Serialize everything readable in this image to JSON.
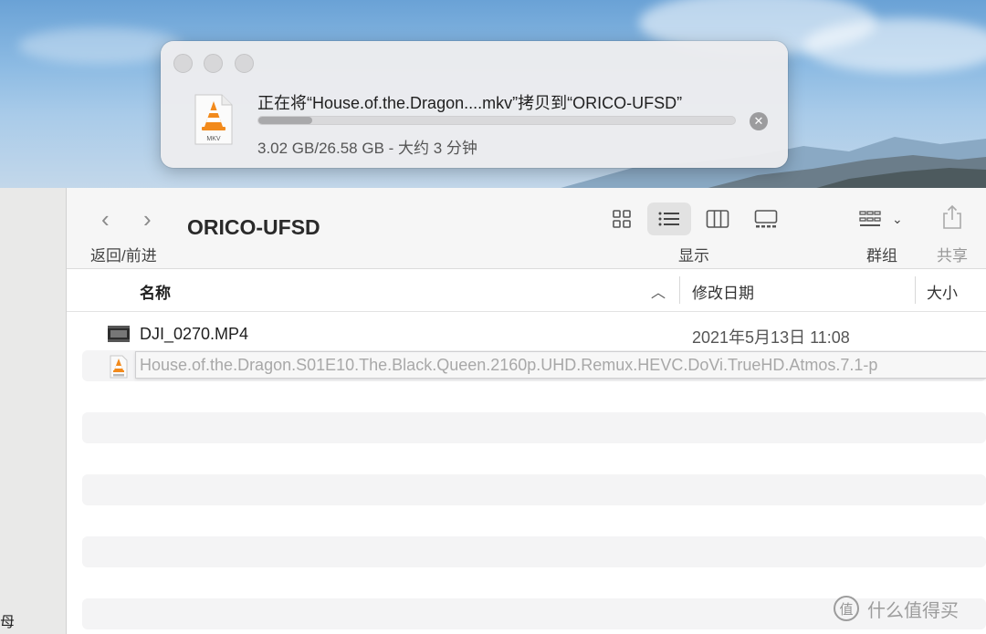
{
  "copy_dialog": {
    "title": "正在将“House.of.the.Dragon....mkv”拷贝到“ORICO-UFSD”",
    "status": "3.02 GB/26.58 GB - 大约 3 分钟",
    "progress_fraction": 0.1136,
    "file_icon_label": "MKV",
    "cancel_icon": "x-circle-icon"
  },
  "toolbar": {
    "back_forward_label": "返回/前进",
    "folder_title": "ORICO-UFSD",
    "view_label": "显示",
    "group_label": "群组",
    "share_label": "共享",
    "views": [
      "icon-view",
      "list-view",
      "column-view",
      "gallery-view"
    ],
    "active_view": "list-view"
  },
  "list_header": {
    "name": "名称",
    "date_modified": "修改日期",
    "size": "大小"
  },
  "rows": [
    {
      "name": "DJI_0270.MP4",
      "date": "2021年5月13日 11:08",
      "icon": "video-file-icon"
    },
    {
      "name": "House.of.the.Dragon.S01E10.The.Black.Queen.2160p.UHD.Remux.HEVC.DoVi.TrueHD.Atmos.7.1-p",
      "date": "",
      "icon": "mkv-file-icon",
      "copying": true
    }
  ],
  "sidebar": {
    "fragment": "母"
  },
  "watermark": {
    "text": "什么值得买",
    "badge": "值"
  }
}
